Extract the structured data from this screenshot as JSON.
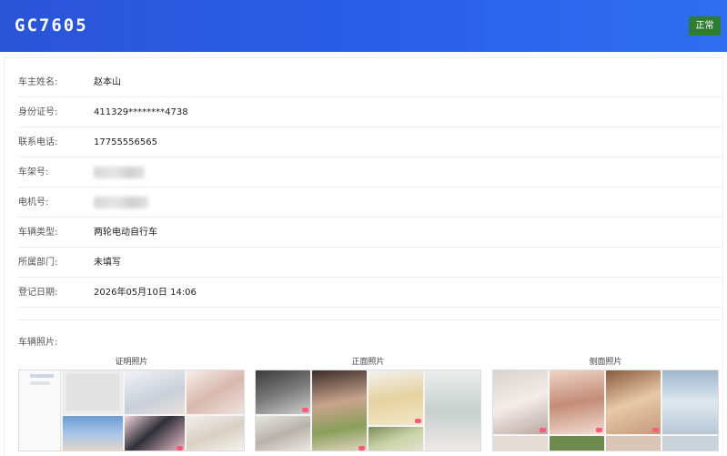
{
  "header": {
    "plate": "GC7605",
    "status": "正常",
    "status_color": "#2f7d32",
    "accent": "#2b54d6"
  },
  "info": [
    {
      "label": "车主姓名:",
      "value": "赵本山"
    },
    {
      "label": "身份证号:",
      "value": "411329********4738"
    },
    {
      "label": "联系电话:",
      "value": "17755556565"
    },
    {
      "label": "车架号:",
      "value": ""
    },
    {
      "label": "电机号:",
      "value": ""
    },
    {
      "label": "车辆类型:",
      "value": "两轮电动自行车"
    },
    {
      "label": "所属部门:",
      "value": "未填写"
    },
    {
      "label": "登记日期:",
      "value": "2026年05月10日 14:06"
    }
  ],
  "photos": {
    "label": "车辆照片:",
    "captions": [
      "证明照片",
      "正面照片",
      "侧面照片"
    ]
  }
}
